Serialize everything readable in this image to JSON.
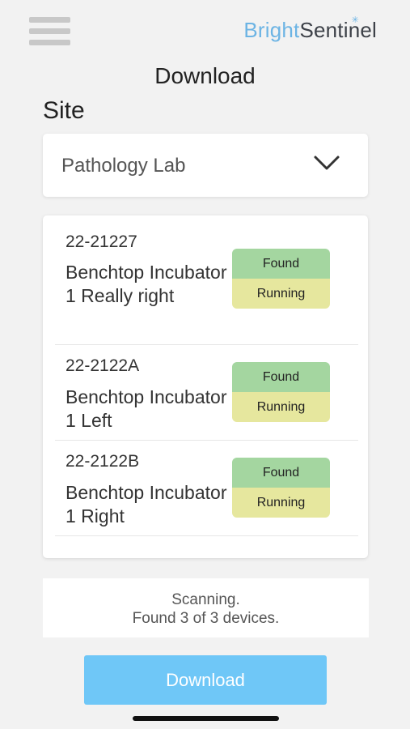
{
  "brand": {
    "part1": "Bright",
    "part2": "Sentinel",
    "accent": "#6cb4e4",
    "dark": "#3d4148"
  },
  "header": {
    "menu_icon": "hamburger-menu-icon",
    "title": "Download"
  },
  "site": {
    "label": "Site",
    "selected": "Pathology Lab",
    "icon": "chevron-down-icon"
  },
  "devices": [
    {
      "serial": "22-21227",
      "name": "Benchtop Incubator 1 Really right",
      "found": "Found",
      "running": "Running"
    },
    {
      "serial": "22-2122A",
      "name": "Benchtop Incubator 1 Left",
      "found": "Found",
      "running": "Running"
    },
    {
      "serial": "22-2122B",
      "name": "Benchtop Incubator 1 Right",
      "found": "Found",
      "running": "Running"
    }
  ],
  "scan": {
    "line1": "Scanning.",
    "line2": "Found 3 of 3 devices."
  },
  "download_button": {
    "label": "Download"
  },
  "colors": {
    "found": "#a4d6a0",
    "running": "#e6e79e",
    "button": "#6fc7f7"
  }
}
